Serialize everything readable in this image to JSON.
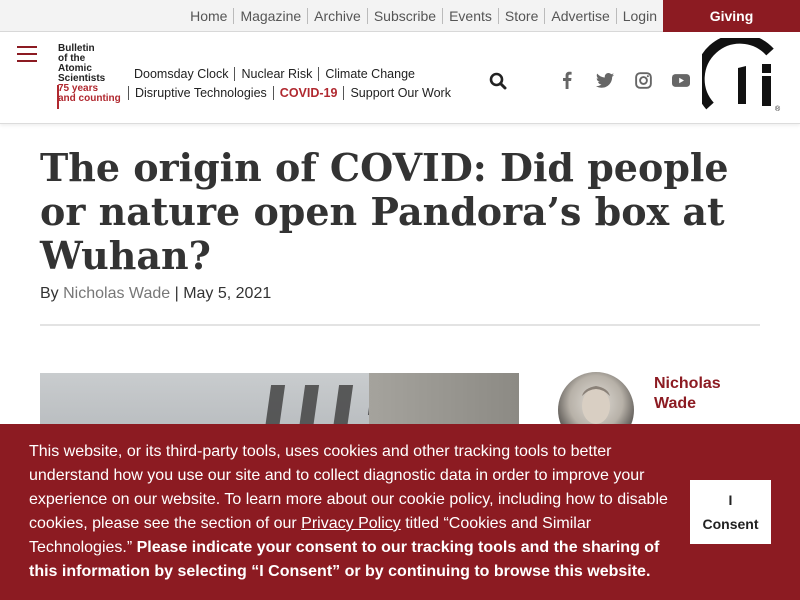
{
  "utility_nav": {
    "links": [
      "Home",
      "Magazine",
      "Archive",
      "Subscribe",
      "Events",
      "Store",
      "Advertise",
      "Login"
    ],
    "giving_label": "Giving"
  },
  "logo": {
    "lines": [
      "Bulletin",
      "of the",
      "Atomic",
      "Scientists"
    ],
    "tagline": [
      "75 years",
      "and counting"
    ]
  },
  "main_nav": {
    "row1": [
      "Doomsday Clock",
      "Nuclear Risk",
      "Climate Change"
    ],
    "row2": [
      "Disruptive Technologies",
      "COVID-19",
      "Support Our Work"
    ],
    "highlight": "COVID-19"
  },
  "icons": {
    "menu": "hamburger-menu-icon",
    "search": "search-icon",
    "social": [
      "facebook-icon",
      "twitter-icon",
      "instagram-icon",
      "youtube-icon"
    ],
    "brand": "doomsday-clock-logo-icon"
  },
  "article": {
    "title": "The origin of COVID: Did people or nature open Pandora’s box at Wuhan?",
    "by_prefix": "By ",
    "author": "Nicholas Wade",
    "separator": " | ",
    "date": "May 5, 2021"
  },
  "author_card": {
    "name": "Nicholas Wade"
  },
  "cookie_banner": {
    "text_before_link": "This website, or its third-party tools, uses cookies and other tracking tools to better understand how you use our site and to collect diagnostic data in order to improve your experience on our website. To learn more about our cookie policy, including how to disable cookies, please see the section of our ",
    "link_text": "Privacy Policy",
    "text_after_link": " titled “Cookies and Similar Technologies.” ",
    "bold_text": "Please indicate your consent to our tracking tools and the sharing of this information by selecting “I Consent” or by continuing to browse this website.",
    "consent_line1": "I",
    "consent_line2": "Consent"
  },
  "colors": {
    "brand_red": "#8c1b22",
    "accent_red": "#b0282f",
    "utility_bg": "#f3f3f3"
  }
}
